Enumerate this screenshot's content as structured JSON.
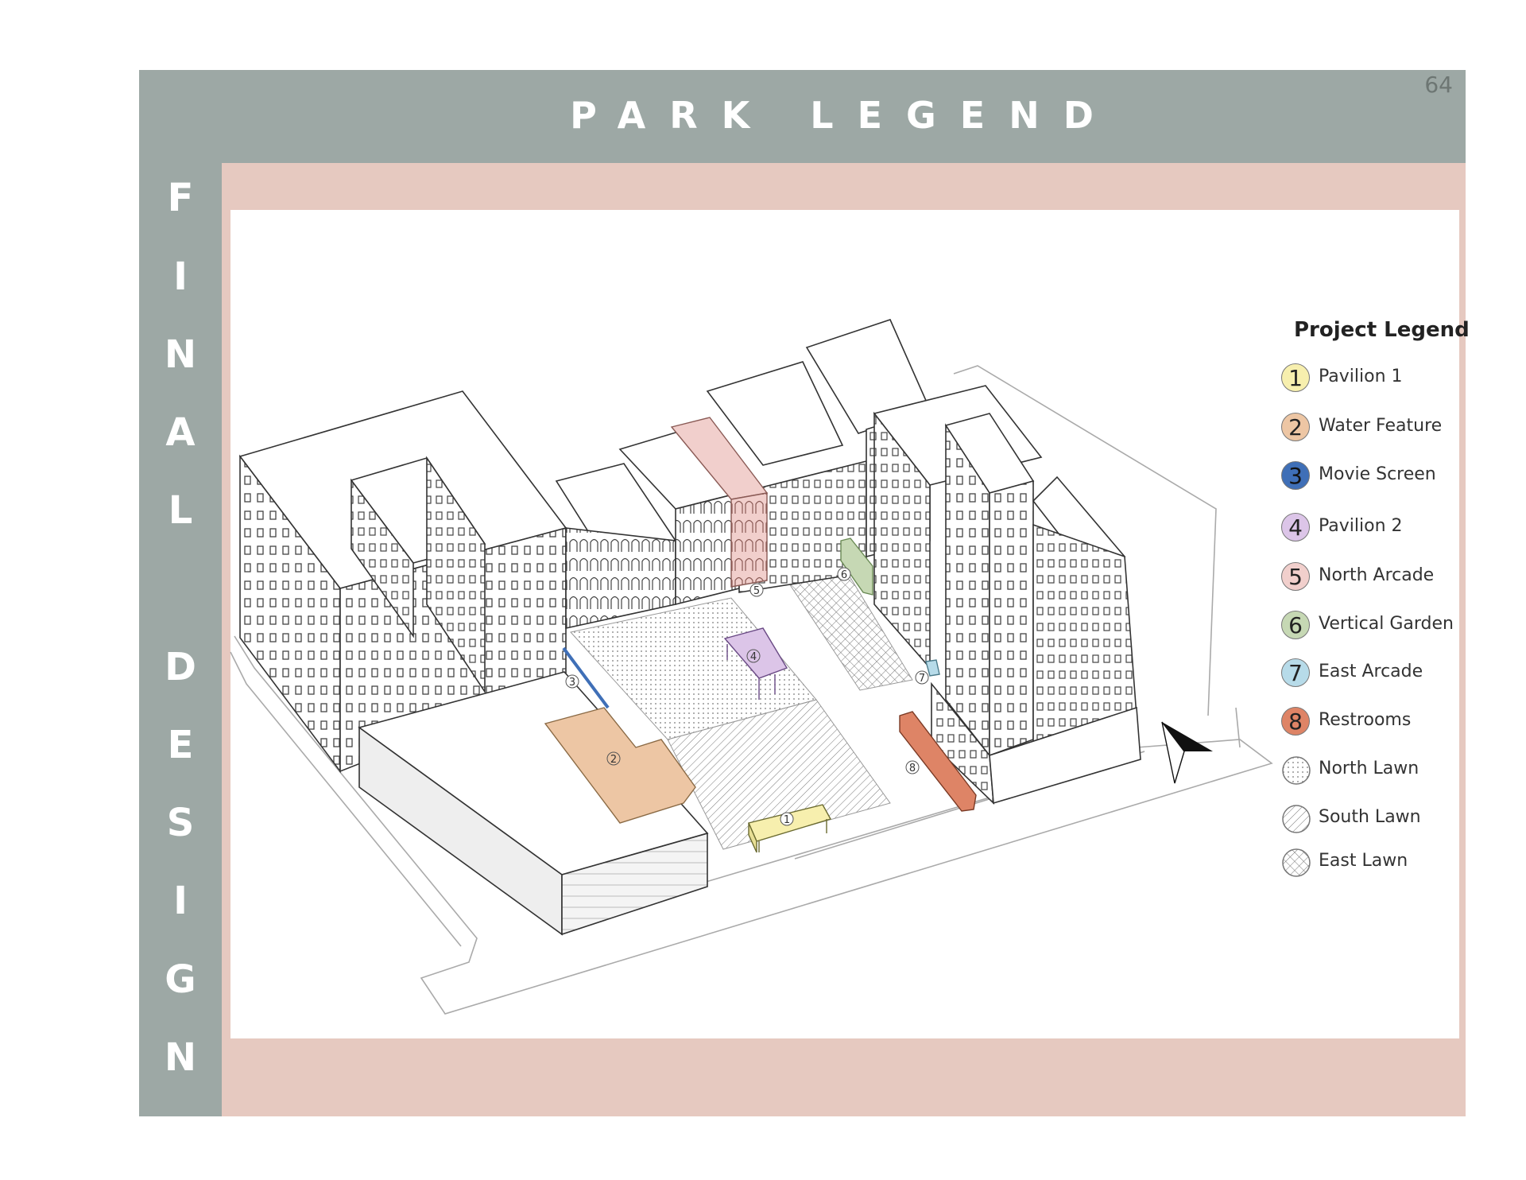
{
  "page": {
    "number": "64"
  },
  "header": {
    "title": "PARK LEGEND"
  },
  "sidebar": {
    "letters": [
      "F",
      "I",
      "N",
      "A",
      "L",
      "D",
      "E",
      "S",
      "I",
      "G",
      "N"
    ]
  },
  "colors": {
    "sidebar": "#9da8a5",
    "frame": "#e6c9c0",
    "pavilion1": "#f7efae",
    "water_feature": "#edc6a4",
    "movie_screen": "#3f6fb7",
    "pavilion2": "#dcc5e8",
    "north_arcade": "#f1cfcc",
    "vertical_garden": "#c6d8b4",
    "east_arcade": "#b7dbe9",
    "restrooms": "#de8466"
  },
  "map_labels": [
    "1",
    "2",
    "3",
    "4",
    "5",
    "6",
    "7",
    "8"
  ],
  "legend": {
    "title": "Project Legend",
    "items": [
      {
        "number": "1",
        "label": "Pavilion 1",
        "color": "#f7efae"
      },
      {
        "number": "2",
        "label": "Water Feature",
        "color": "#edc6a4"
      },
      {
        "number": "3",
        "label": "Movie Screen",
        "color": "#3f6fb7"
      },
      {
        "number": "4",
        "label": "Pavilion 2",
        "color": "#dcc5e8"
      },
      {
        "number": "5",
        "label": "North Arcade",
        "color": "#f1cfcc"
      },
      {
        "number": "6",
        "label": "Vertical Garden",
        "color": "#c6d8b4"
      },
      {
        "number": "7",
        "label": "East Arcade",
        "color": "#b7dbe9"
      },
      {
        "number": "8",
        "label": "Restrooms",
        "color": "#de8466"
      },
      {
        "label": "North Lawn",
        "pattern": "dots"
      },
      {
        "label": "South Lawn",
        "pattern": "diagonal"
      },
      {
        "label": "East Lawn",
        "pattern": "crosshatch"
      }
    ]
  }
}
